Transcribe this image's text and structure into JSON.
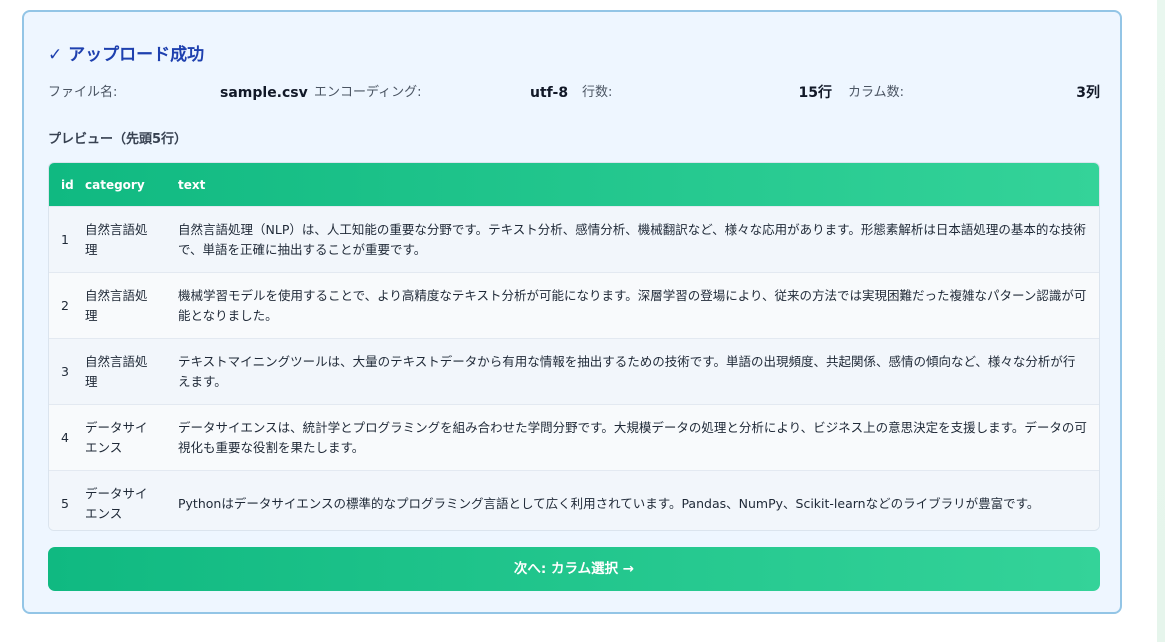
{
  "upload": {
    "title": "✓ アップロード成功",
    "file_label": "ファイル名:",
    "file_value": "sample.csv",
    "encoding_label": "エンコーディング:",
    "encoding_value": "utf-8",
    "rows_label": "行数:",
    "rows_value": "15行",
    "columns_label": "カラム数:",
    "columns_value": "3列"
  },
  "preview": {
    "title": "プレビュー（先頭5行）",
    "headers": [
      "id",
      "category",
      "text"
    ],
    "rows": [
      [
        "1",
        "自然言語処理",
        "自然言語処理（NLP）は、人工知能の重要な分野です。テキスト分析、感情分析、機械翻訳など、様々な応用があります。形態素解析は日本語処理の基本的な技術で、単語を正確に抽出することが重要です。"
      ],
      [
        "2",
        "自然言語処理",
        "機械学習モデルを使用することで、より高精度なテキスト分析が可能になります。深層学習の登場により、従来の方法では実現困難だった複雑なパターン認識が可能となりました。"
      ],
      [
        "3",
        "自然言語処理",
        "テキストマイニングツールは、大量のテキストデータから有用な情報を抽出するための技術です。単語の出現頻度、共起関係、感情の傾向など、様々な分析が行えます。"
      ],
      [
        "4",
        "データサイエンス",
        "データサイエンスは、統計学とプログラミングを組み合わせた学問分野です。大規模データの処理と分析により、ビジネス上の意思決定を支援します。データの可視化も重要な役割を果たします。"
      ],
      [
        "5",
        "データサイエンス",
        "Pythonはデータサイエンスの標準的なプログラミング言語として広く利用されています。Pandas、NumPy、Scikit-learnなどのライブラリが豊富です。"
      ]
    ]
  },
  "actions": {
    "next_label": "次へ: カラム選択 →"
  }
}
